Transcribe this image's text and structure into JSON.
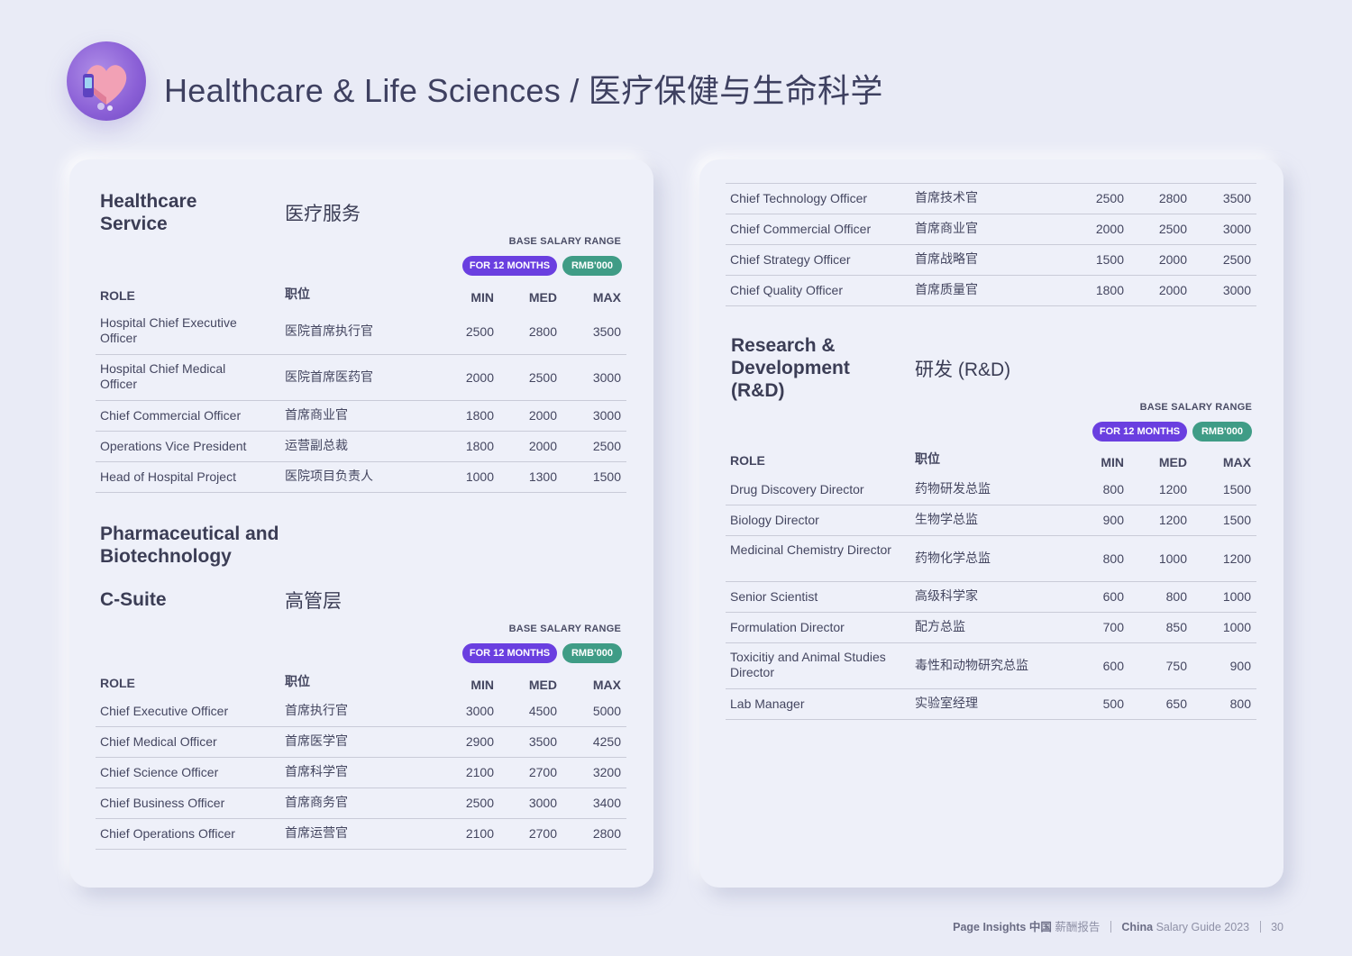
{
  "header": {
    "title": "Healthcare & Life Sciences / 医疗保健与生命科学",
    "icon": "healthcare-heart-icon"
  },
  "common": {
    "base_range": "BASE SALARY RANGE",
    "pill_months": "FOR 12 MONTHS",
    "pill_rmb": "RMB'000",
    "col_role": "ROLE",
    "col_role_cn": "职位",
    "col_min": "MIN",
    "col_med": "MED",
    "col_max": "MAX"
  },
  "healthcare_service": {
    "title": "Healthcare Service",
    "title_cn": "医疗服务",
    "rows": [
      {
        "role": "Hospital Chief Executive Officer",
        "cn": "医院首席执行官",
        "min": "2500",
        "med": "2800",
        "max": "3500"
      },
      {
        "role": "Hospital Chief Medical Officer",
        "cn": "医院首席医药官",
        "min": "2000",
        "med": "2500",
        "max": "3000"
      },
      {
        "role": "Chief Commercial Officer",
        "cn": "首席商业官",
        "min": "1800",
        "med": "2000",
        "max": "3000"
      },
      {
        "role": "Operations Vice President",
        "cn": "运营副总裁",
        "min": "1800",
        "med": "2000",
        "max": "2500"
      },
      {
        "role": "Head of Hospital Project",
        "cn": "医院项目负责人",
        "min": "1000",
        "med": "1300",
        "max": "1500"
      }
    ]
  },
  "pharma": {
    "title": "Pharmaceutical and Biotechnology",
    "sub_title": "C-Suite",
    "sub_title_cn": "高管层",
    "rows": [
      {
        "role": "Chief Executive Officer",
        "cn": "首席执行官",
        "min": "3000",
        "med": "4500",
        "max": "5000"
      },
      {
        "role": "Chief Medical Officer",
        "cn": "首席医学官",
        "min": "2900",
        "med": "3500",
        "max": "4250"
      },
      {
        "role": "Chief Science Officer",
        "cn": "首席科学官",
        "min": "2100",
        "med": "2700",
        "max": "3200"
      },
      {
        "role": "Chief Business Officer",
        "cn": "首席商务官",
        "min": "2500",
        "med": "3000",
        "max": "3400"
      },
      {
        "role": "Chief Operations Officer",
        "cn": "首席运营官",
        "min": "2100",
        "med": "2700",
        "max": "2800"
      }
    ]
  },
  "csuite_cont": {
    "rows": [
      {
        "role": "Chief Technology Officer",
        "cn": "首席技术官",
        "min": "2500",
        "med": "2800",
        "max": "3500"
      },
      {
        "role": "Chief Commercial Officer",
        "cn": "首席商业官",
        "min": "2000",
        "med": "2500",
        "max": "3000"
      },
      {
        "role": "Chief Strategy Officer",
        "cn": "首席战略官",
        "min": "1500",
        "med": "2000",
        "max": "2500"
      },
      {
        "role": "Chief Quality Officer",
        "cn": "首席质量官",
        "min": "1800",
        "med": "2000",
        "max": "3000"
      }
    ]
  },
  "rnd": {
    "title": "Research & Development (R&D)",
    "title_cn": "研发 (R&D)",
    "rows": [
      {
        "role": "Drug Discovery Director",
        "cn": "药物研发总监",
        "min": "800",
        "med": "1200",
        "max": "1500"
      },
      {
        "role": "Biology Director",
        "cn": "生物学总监",
        "min": "900",
        "med": "1200",
        "max": "1500"
      },
      {
        "role": "Medicinal Chemistry Director",
        "cn": "药物化学总监",
        "min": "800",
        "med": "1000",
        "max": "1200"
      },
      {
        "role": "Senior Scientist",
        "cn": "高级科学家",
        "min": "600",
        "med": "800",
        "max": "1000"
      },
      {
        "role": "Formulation Director",
        "cn": "配方总监",
        "min": "700",
        "med": "850",
        "max": "1000"
      },
      {
        "role": "Toxicitiy and Animal Studies Director",
        "cn": "毒性和动物研究总监",
        "min": "600",
        "med": "750",
        "max": "900"
      },
      {
        "role": "Lab Manager",
        "cn": "实验室经理",
        "min": "500",
        "med": "650",
        "max": "800"
      }
    ]
  },
  "footer": {
    "brand": "Page Insights",
    "brand_cn": "中国",
    "brand_cn2": "薪酬报告",
    "guide_bold": "China",
    "guide": "Salary Guide 2023",
    "page": "30"
  }
}
